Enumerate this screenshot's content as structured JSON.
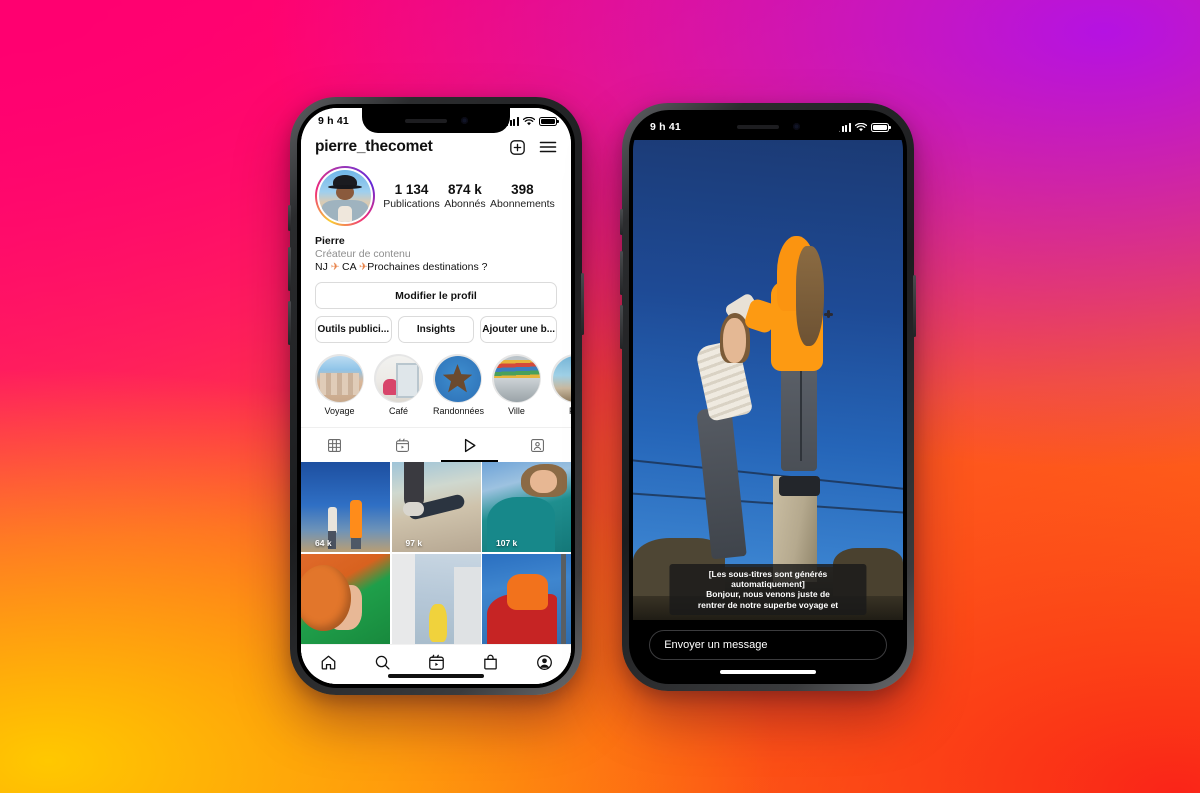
{
  "background": {
    "colors": [
      "#ff0070",
      "#b512e2",
      "#ffc800",
      "#fa2418"
    ],
    "description": "Instagram brand gradient"
  },
  "left_phone": {
    "status_bar": {
      "time": "9 h 41",
      "signal_icon": "cellular-bars-icon",
      "wifi_icon": "wifi-icon",
      "battery_icon": "battery-full-icon"
    },
    "header": {
      "username": "pierre_thecomet",
      "add_icon": "plus-square-icon",
      "menu_icon": "hamburger-menu-icon"
    },
    "profile": {
      "avatar_name": "profile-avatar",
      "stats": [
        {
          "value": "1 134",
          "label": "Publications"
        },
        {
          "value": "874 k",
          "label": "Abonnés"
        },
        {
          "value": "398",
          "label": "Abonnements"
        }
      ],
      "bio_name": "Pierre",
      "bio_category": "Créateur de contenu",
      "bio_line": "NJ ✈ CA ✈ Prochaines destinations ?",
      "bio_part1": "NJ",
      "bio_emoji": "✈",
      "bio_part2": "CA",
      "bio_part3": "Prochaines destinations ?"
    },
    "actions": {
      "edit_profile": "Modifier le profil",
      "promo_tools": "Outils publici...",
      "insights": "Insights",
      "add_bio": "Ajouter une b..."
    },
    "highlights": [
      {
        "label": "Voyage"
      },
      {
        "label": "Café"
      },
      {
        "label": "Randonnées"
      },
      {
        "label": "Ville"
      },
      {
        "label": "Pla"
      }
    ],
    "content_tabs": [
      {
        "icon": "grid-icon",
        "active": false
      },
      {
        "icon": "reels-icon",
        "active": false
      },
      {
        "icon": "play-icon",
        "active": true
      },
      {
        "icon": "tagged-person-icon",
        "active": false
      }
    ],
    "grid": [
      {
        "views": "64 k",
        "alt": "two-people-on-pedestal"
      },
      {
        "views": "97 k",
        "alt": "skateboard"
      },
      {
        "views": "107 k",
        "alt": "woman-in-teal-coat"
      },
      {
        "views": "",
        "alt": "basketball-and-green-jacket"
      },
      {
        "views": "",
        "alt": "buildings-and-yellow-sculpture"
      },
      {
        "views": "",
        "alt": "dancer-in-red-and-orange"
      }
    ],
    "bottom_nav": [
      {
        "icon": "home-icon",
        "active": false
      },
      {
        "icon": "search-icon",
        "active": false
      },
      {
        "icon": "reels-icon",
        "active": false
      },
      {
        "icon": "shop-bag-icon",
        "active": false
      },
      {
        "icon": "profile-icon",
        "active": true
      }
    ]
  },
  "right_phone": {
    "status_bar": {
      "time": "9 h 41",
      "signal_icon": "cellular-bars-icon",
      "wifi_icon": "wifi-icon",
      "battery_icon": "battery-full-icon"
    },
    "video": {
      "alt": "two-people-standing-on-concrete-pedestal-against-blue-sky"
    },
    "captions": {
      "line1": "[Les sous-titres sont générés",
      "line2": "automatiquement]",
      "line3": "Bonjour, nous venons juste de",
      "line4": "rentrer de notre superbe voyage et"
    },
    "message_field": {
      "placeholder": "Envoyer un message",
      "value": "Envoyer un message"
    }
  }
}
